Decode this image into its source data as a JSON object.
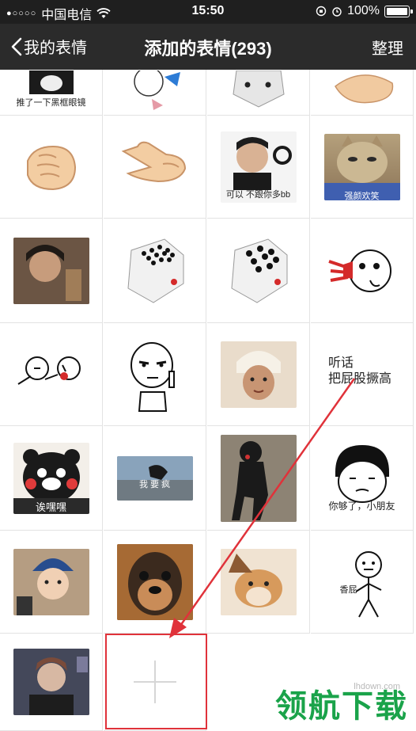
{
  "status_bar": {
    "signal_dots": "●○○○○",
    "carrier": "中国电信",
    "wifi_icon": "wifi-icon",
    "time": "15:50",
    "battery_percent": "100%"
  },
  "nav": {
    "back_label": "我的表情",
    "title": "添加的表情(293)",
    "action_label": "整理"
  },
  "stickers": {
    "captions": {
      "r0c0": "推了一下黑框眼镜",
      "r1c2": "可以 不跟你多bb",
      "r1c3": "强颜欢笑",
      "r3c3_line1": "听话",
      "r3c3_line2": "把屁股撅高",
      "r4c0": "诶嘿嘿",
      "r4c1": "我 要 疯",
      "r4c3": "你够了，小朋友",
      "r5c3": "香屁"
    }
  },
  "watermark": {
    "url": "lhdown.com",
    "text": "领航下载"
  },
  "colors": {
    "status_bg": "#1f1f1f",
    "nav_bg": "#2b2b2b",
    "highlight": "#e0323a",
    "watermark": "#1aa34a"
  }
}
